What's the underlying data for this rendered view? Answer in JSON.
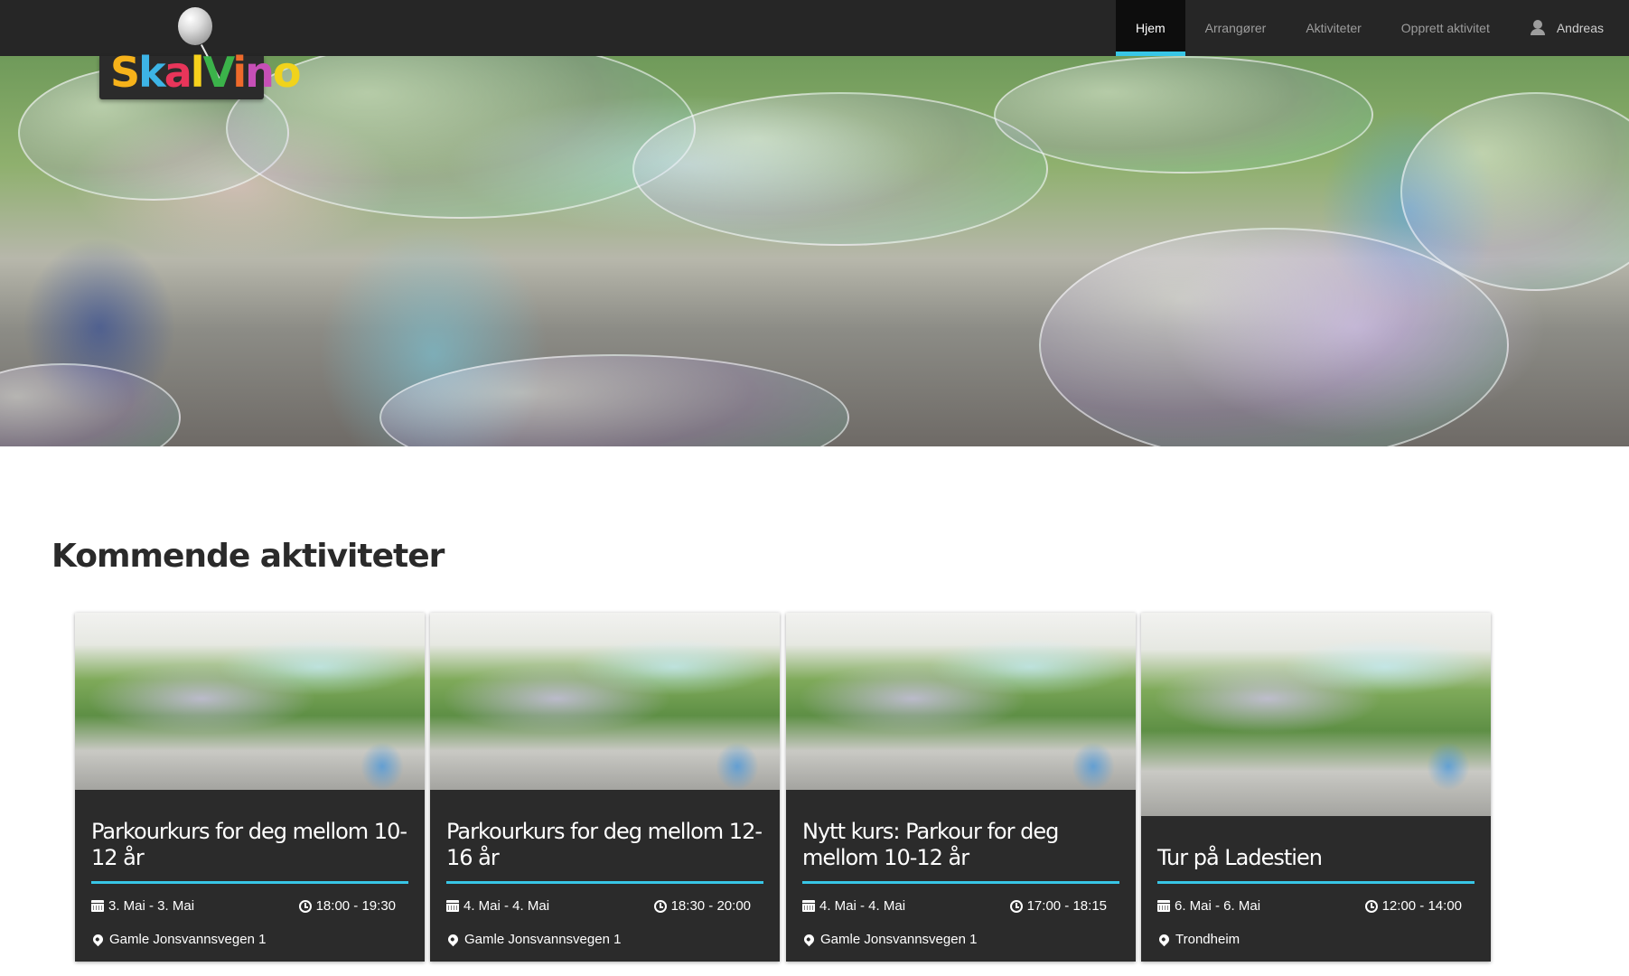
{
  "brand": {
    "letters": [
      "S",
      "k",
      "a",
      "l",
      "V",
      "i",
      "n",
      "o"
    ]
  },
  "nav": {
    "items": [
      {
        "label": "Hjem",
        "active": true
      },
      {
        "label": "Arrangører",
        "active": false
      },
      {
        "label": "Aktiviteter",
        "active": false
      },
      {
        "label": "Opprett aktivitet",
        "active": false
      }
    ],
    "user_name": "Andreas"
  },
  "section": {
    "title": "Kommende aktiviteter"
  },
  "cards": [
    {
      "title": "Parkourkurs for deg mellom 10-12 år",
      "date": "3. Mai - 3. Mai",
      "time": "18:00 - 19:30",
      "location": "Gamle Jonsvannsvegen 1"
    },
    {
      "title": "Parkourkurs for deg mellom 12-16 år",
      "date": "4. Mai - 4. Mai",
      "time": "18:30 - 20:00",
      "location": "Gamle Jonsvannsvegen 1"
    },
    {
      "title": "Nytt kurs: Parkour for deg mellom 10-12 år",
      "date": "4. Mai - 4. Mai",
      "time": "17:00 - 18:15",
      "location": "Gamle Jonsvannsvegen 1"
    },
    {
      "title": "Tur på Ladestien",
      "date": "6. Mai - 6. Mai",
      "time": "12:00 - 14:00",
      "location": "Trondheim"
    }
  ],
  "colors": {
    "navbar": "#262626",
    "accent": "#38c6e6",
    "card_bg": "#2b2b2b"
  }
}
